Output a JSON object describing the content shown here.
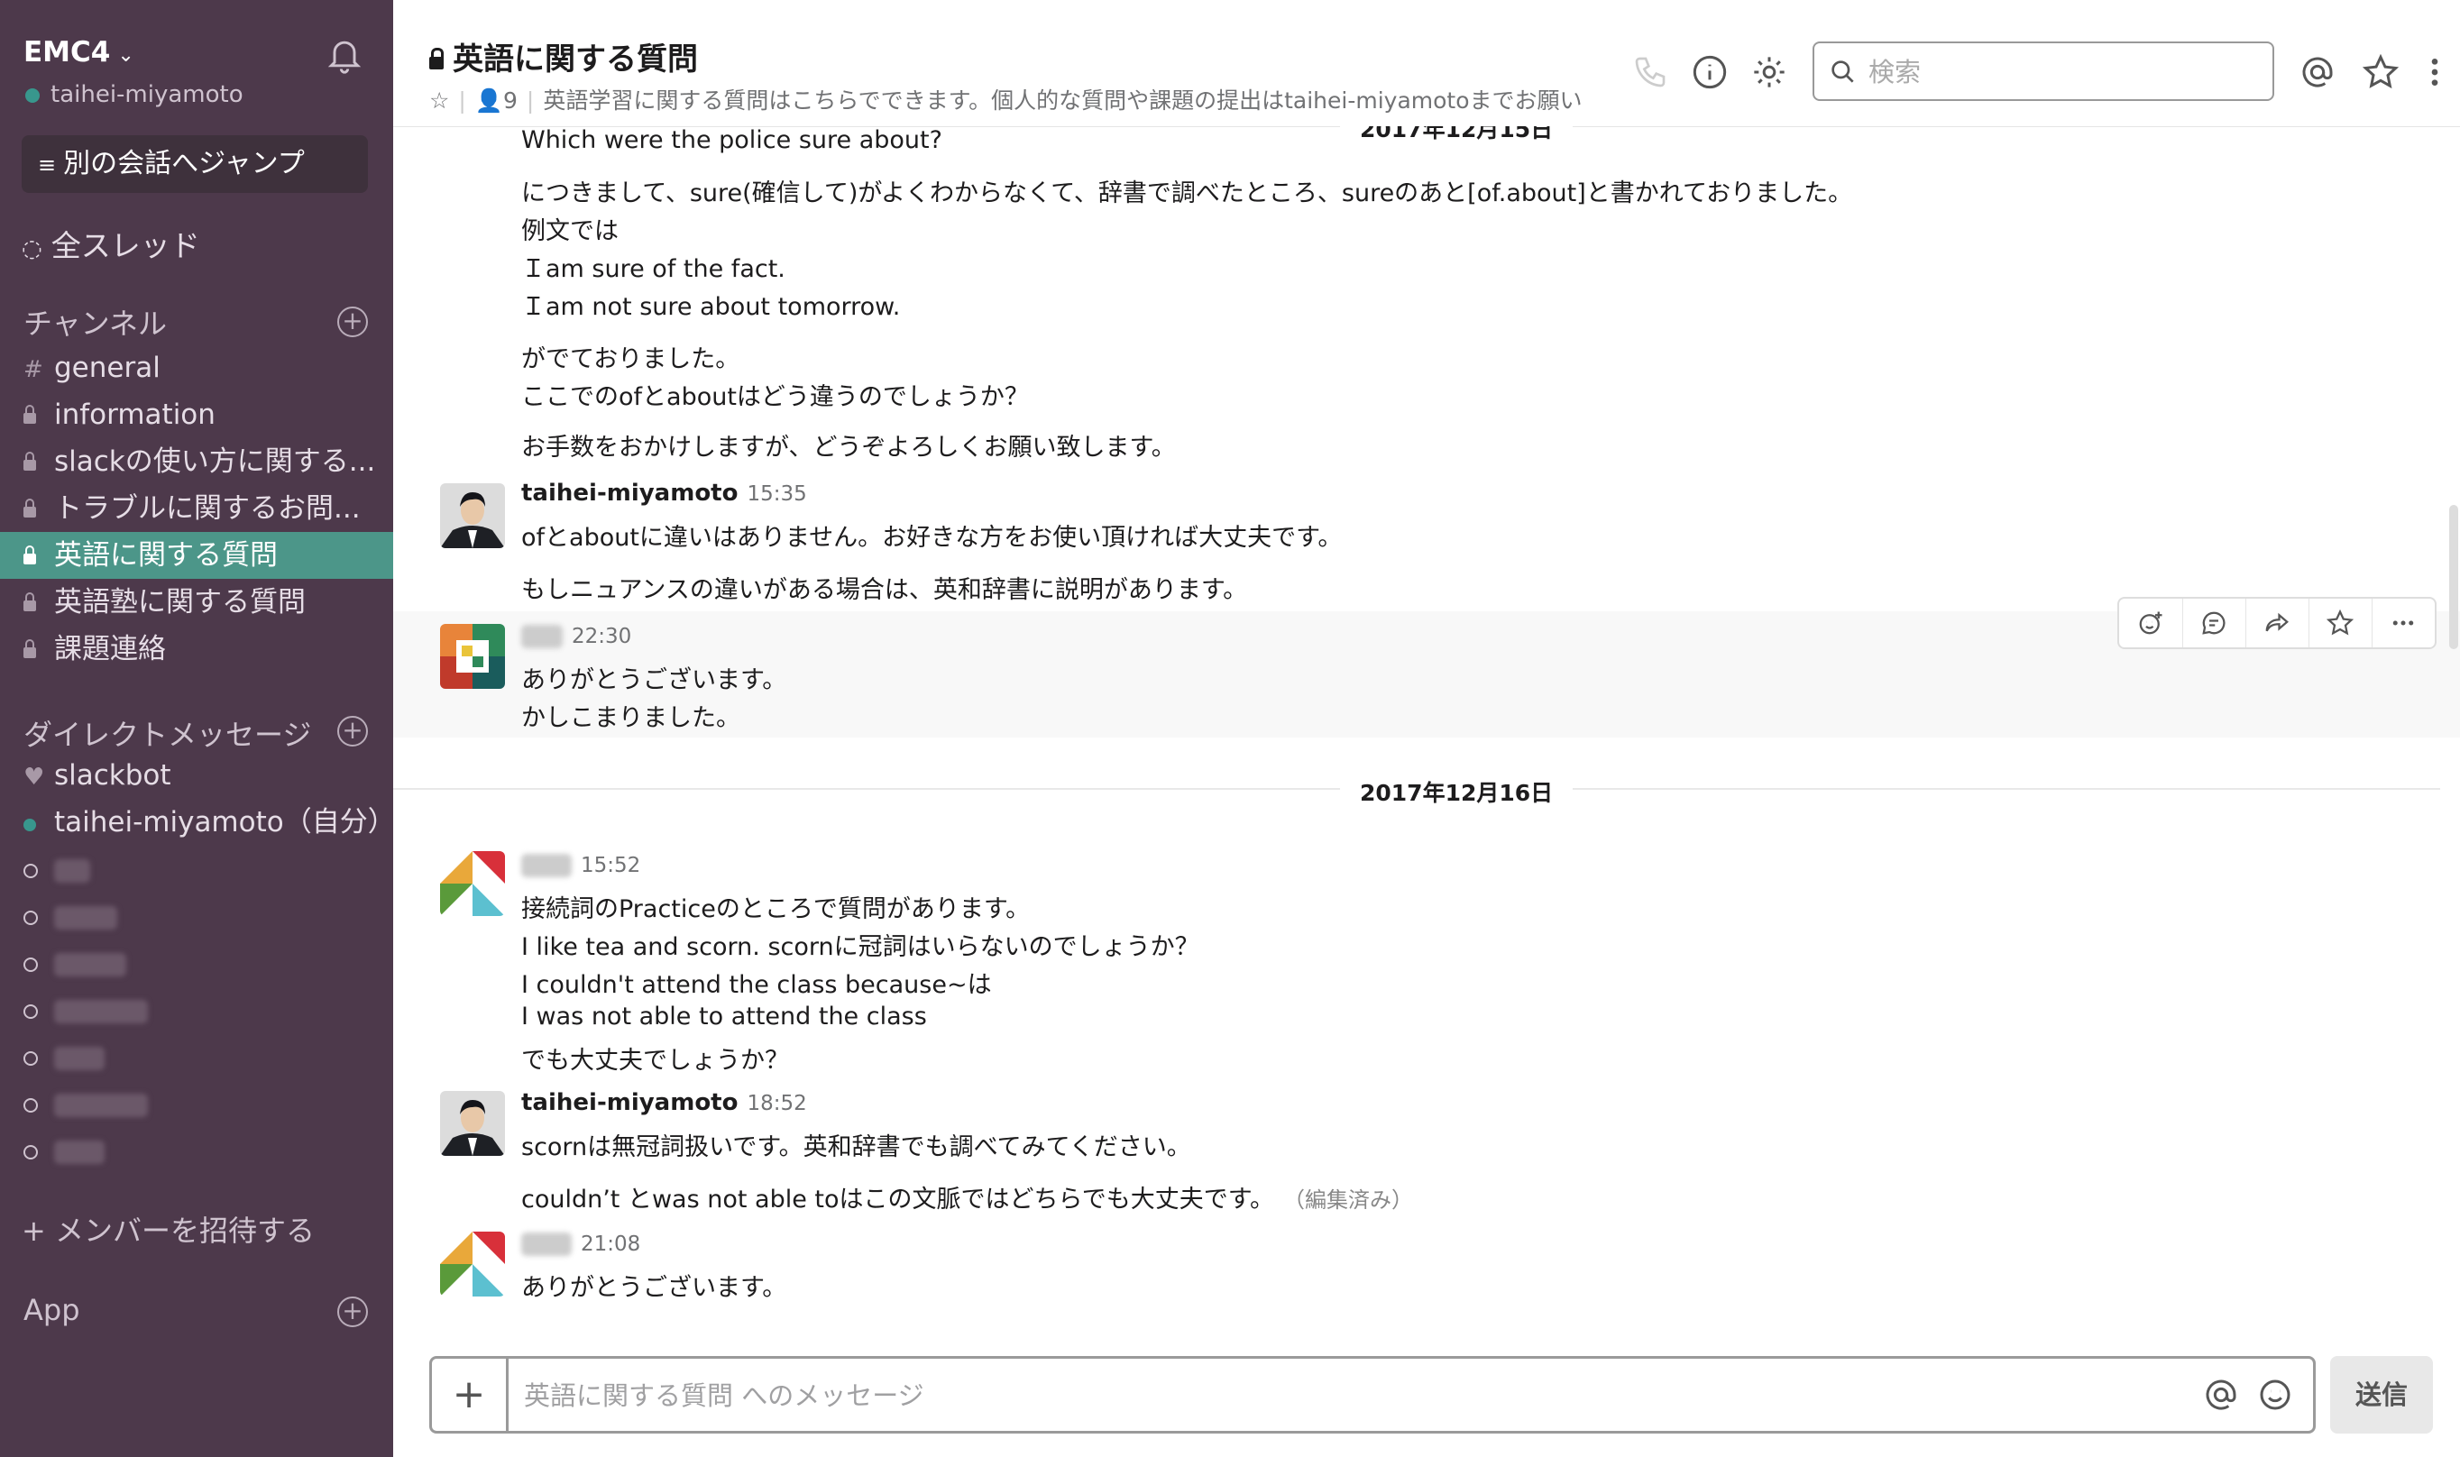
{
  "workspace": {
    "name": "EMC4",
    "user": "taihei-miyamoto"
  },
  "sidebar": {
    "jump_label": "別の会話へジャンプ",
    "all_threads": "全スレッド",
    "channels_heading": "チャンネル",
    "channels": [
      {
        "name": "general",
        "private": false,
        "active": false
      },
      {
        "name": "information",
        "private": true,
        "active": false
      },
      {
        "name": "slackの使い方に関する...",
        "private": true,
        "active": false
      },
      {
        "name": "トラブルに関するお問...",
        "private": true,
        "active": false
      },
      {
        "name": "英語に関する質問",
        "private": true,
        "active": true
      },
      {
        "name": "英語塾に関する質問",
        "private": true,
        "active": false
      },
      {
        "name": "課題連絡",
        "private": true,
        "active": false
      }
    ],
    "dm_heading": "ダイレクトメッセージ",
    "dms": [
      {
        "name": "slackbot"
      },
      {
        "name": "taihei-miyamoto（自分）"
      }
    ],
    "invite": "メンバーを招待する",
    "app": "App"
  },
  "header": {
    "title": "英語に関する質問",
    "member_count": "9",
    "topic": "英語学習に関する質問はこちらでできます。個人的な質問や課題の提出はtaihei-miyamotoまでお願い",
    "search_placeholder": "検索"
  },
  "messages": {
    "day1": "2017年12月15日",
    "m1_lines": [
      "Which were the police sure about?",
      "につきまして、sure(確信して)がよくわからなくて、辞書で調べたところ、sureのあと[of.about]と書かれておりました。",
      "例文では",
      "Ｉam sure of the fact.",
      "Ｉam not sure about tomorrow.",
      "がでておりました。",
      "ここでのofとaboutはどう違うのでしょうか？",
      "お手数をおかけしますが、どうぞよろしくお願い致します。"
    ],
    "m2_author": "taihei-miyamoto",
    "m2_time": "15:35",
    "m2_lines": [
      "ofとaboutに違いはありません。お好きな方をお使い頂ければ大丈夫です。",
      "もしニュアンスの違いがある場合は、英和辞書に説明があります。"
    ],
    "m3_time": "22:30",
    "m3_lines": [
      "ありがとうございます。",
      "かしこまりました。"
    ],
    "day2": "2017年12月16日",
    "m4_time": "15:52",
    "m4_lines": [
      "接続詞のPracticeのところで質問があります。",
      "I like tea and scorn. scornに冠詞はいらないのでしょうか？",
      "I couldn't attend the class because~は",
      "I was not able to attend the class",
      "でも大丈夫でしょうか？"
    ],
    "m5_author": "taihei-miyamoto",
    "m5_time": "18:52",
    "m5_lines": [
      "scornは無冠詞扱いです。英和辞書でも調べてみてください。",
      "couldn’t とwas not able toはこの文脈ではどちらでも大丈夫です。"
    ],
    "m5_edited": "（編集済み）",
    "m6_time": "21:08",
    "m6_lines": [
      "ありがとうございます。"
    ]
  },
  "composer": {
    "placeholder": "英語に関する質問 へのメッセージ",
    "send_label": "送信"
  }
}
